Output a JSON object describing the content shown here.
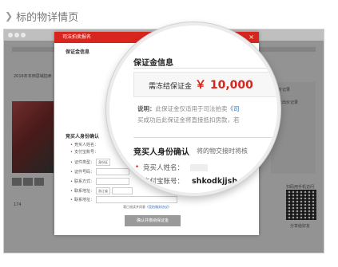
{
  "section": {
    "title": "标的物详情页"
  },
  "modal": {
    "header": "司法拍卖报名",
    "section_deposit": "保证金信息",
    "section_buyer": "竞买人身份确认",
    "fields": [
      {
        "label": "竞买人姓名："
      },
      {
        "label": "支付宝账号："
      },
      {
        "label": "证件类型："
      },
      {
        "label": "证件号码："
      },
      {
        "label": "联系方式："
      },
      {
        "label": "联系地址："
      },
      {
        "label": "联系地址："
      }
    ],
    "select_cert": "身份证",
    "select_province": "浙江省",
    "agree_prefix": "我已阅读并同意",
    "agree_link": "《竞拍服务协议》",
    "confirm_button": "确认并缴纳保证金"
  },
  "magnifier": {
    "deposit_title": "保证金信息",
    "deposit_label": "需冻结保证金",
    "deposit_value": "￥ 10,000",
    "desc_label": "说明：",
    "desc_line1": "此保证金仅适用于司法拍卖",
    "desc_link": "《司",
    "desc_line2": "买成功后此保证金将直接抵扣房款，若",
    "confirm_title": "竞买人身份确认",
    "confirm_sub": "将的物交接时将核",
    "name_label": "竞买人姓名：",
    "alipay_label": "支付宝账号：",
    "alipay_value": "shkodkjjsh"
  },
  "background": {
    "page_title": "2016年本田思域拍卖",
    "side_title": "竞价记录",
    "side_empty": "暂无出价记录",
    "count_text": "174",
    "qr_caption": "扫码用手机访问",
    "share_text": "分享给好友"
  },
  "colors": {
    "accent": "#d8251e",
    "link": "#2f6db5",
    "button_disabled": "#9a9a9a"
  }
}
